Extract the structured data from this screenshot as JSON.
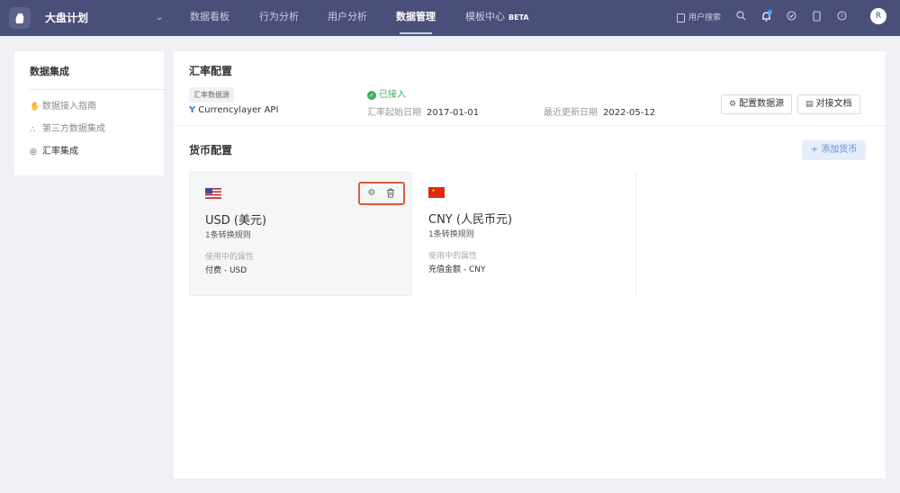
{
  "topbar": {
    "project": "大盘计划",
    "nav": [
      "数据看板",
      "行为分析",
      "用户分析",
      "数据管理",
      "模板中心"
    ],
    "active": "数据管理",
    "beta": "BETA",
    "user_search": "用户搜索",
    "avatar": "R"
  },
  "sidebar": {
    "title": "数据集成",
    "items": [
      {
        "label": "数据接入指南",
        "icon": "hand-icon"
      },
      {
        "label": "第三方数据集成",
        "icon": "nodes-icon"
      },
      {
        "label": "汇率集成",
        "icon": "target-icon",
        "active": true
      }
    ]
  },
  "rate": {
    "title": "汇率配置",
    "source_tag": "汇率数据源",
    "api": "Currencylayer API",
    "status": "已接入",
    "start_label": "汇率起始日期",
    "start_value": "2017-01-01",
    "update_label": "最近更新日期",
    "update_value": "2022-05-12",
    "btn_config": "配置数据源",
    "btn_docs": "对接文档"
  },
  "currency": {
    "title": "货币配置",
    "add": "+ 添加货币",
    "cards": [
      {
        "name": "USD (美元)",
        "rule": "1条转换规则",
        "prop_label": "使用中的属性",
        "prop_value": "付费 - USD",
        "flag": "us"
      },
      {
        "name": "CNY (人民币元)",
        "rule": "1条转换规则",
        "prop_label": "使用中的属性",
        "prop_value": "充值金额 - CNY",
        "flag": "cn"
      }
    ]
  },
  "colors": {
    "nav_bg": "#4a4f7a",
    "success": "#3fae5a",
    "accent": "#5b8fe0",
    "highlight": "#e05a3a"
  }
}
